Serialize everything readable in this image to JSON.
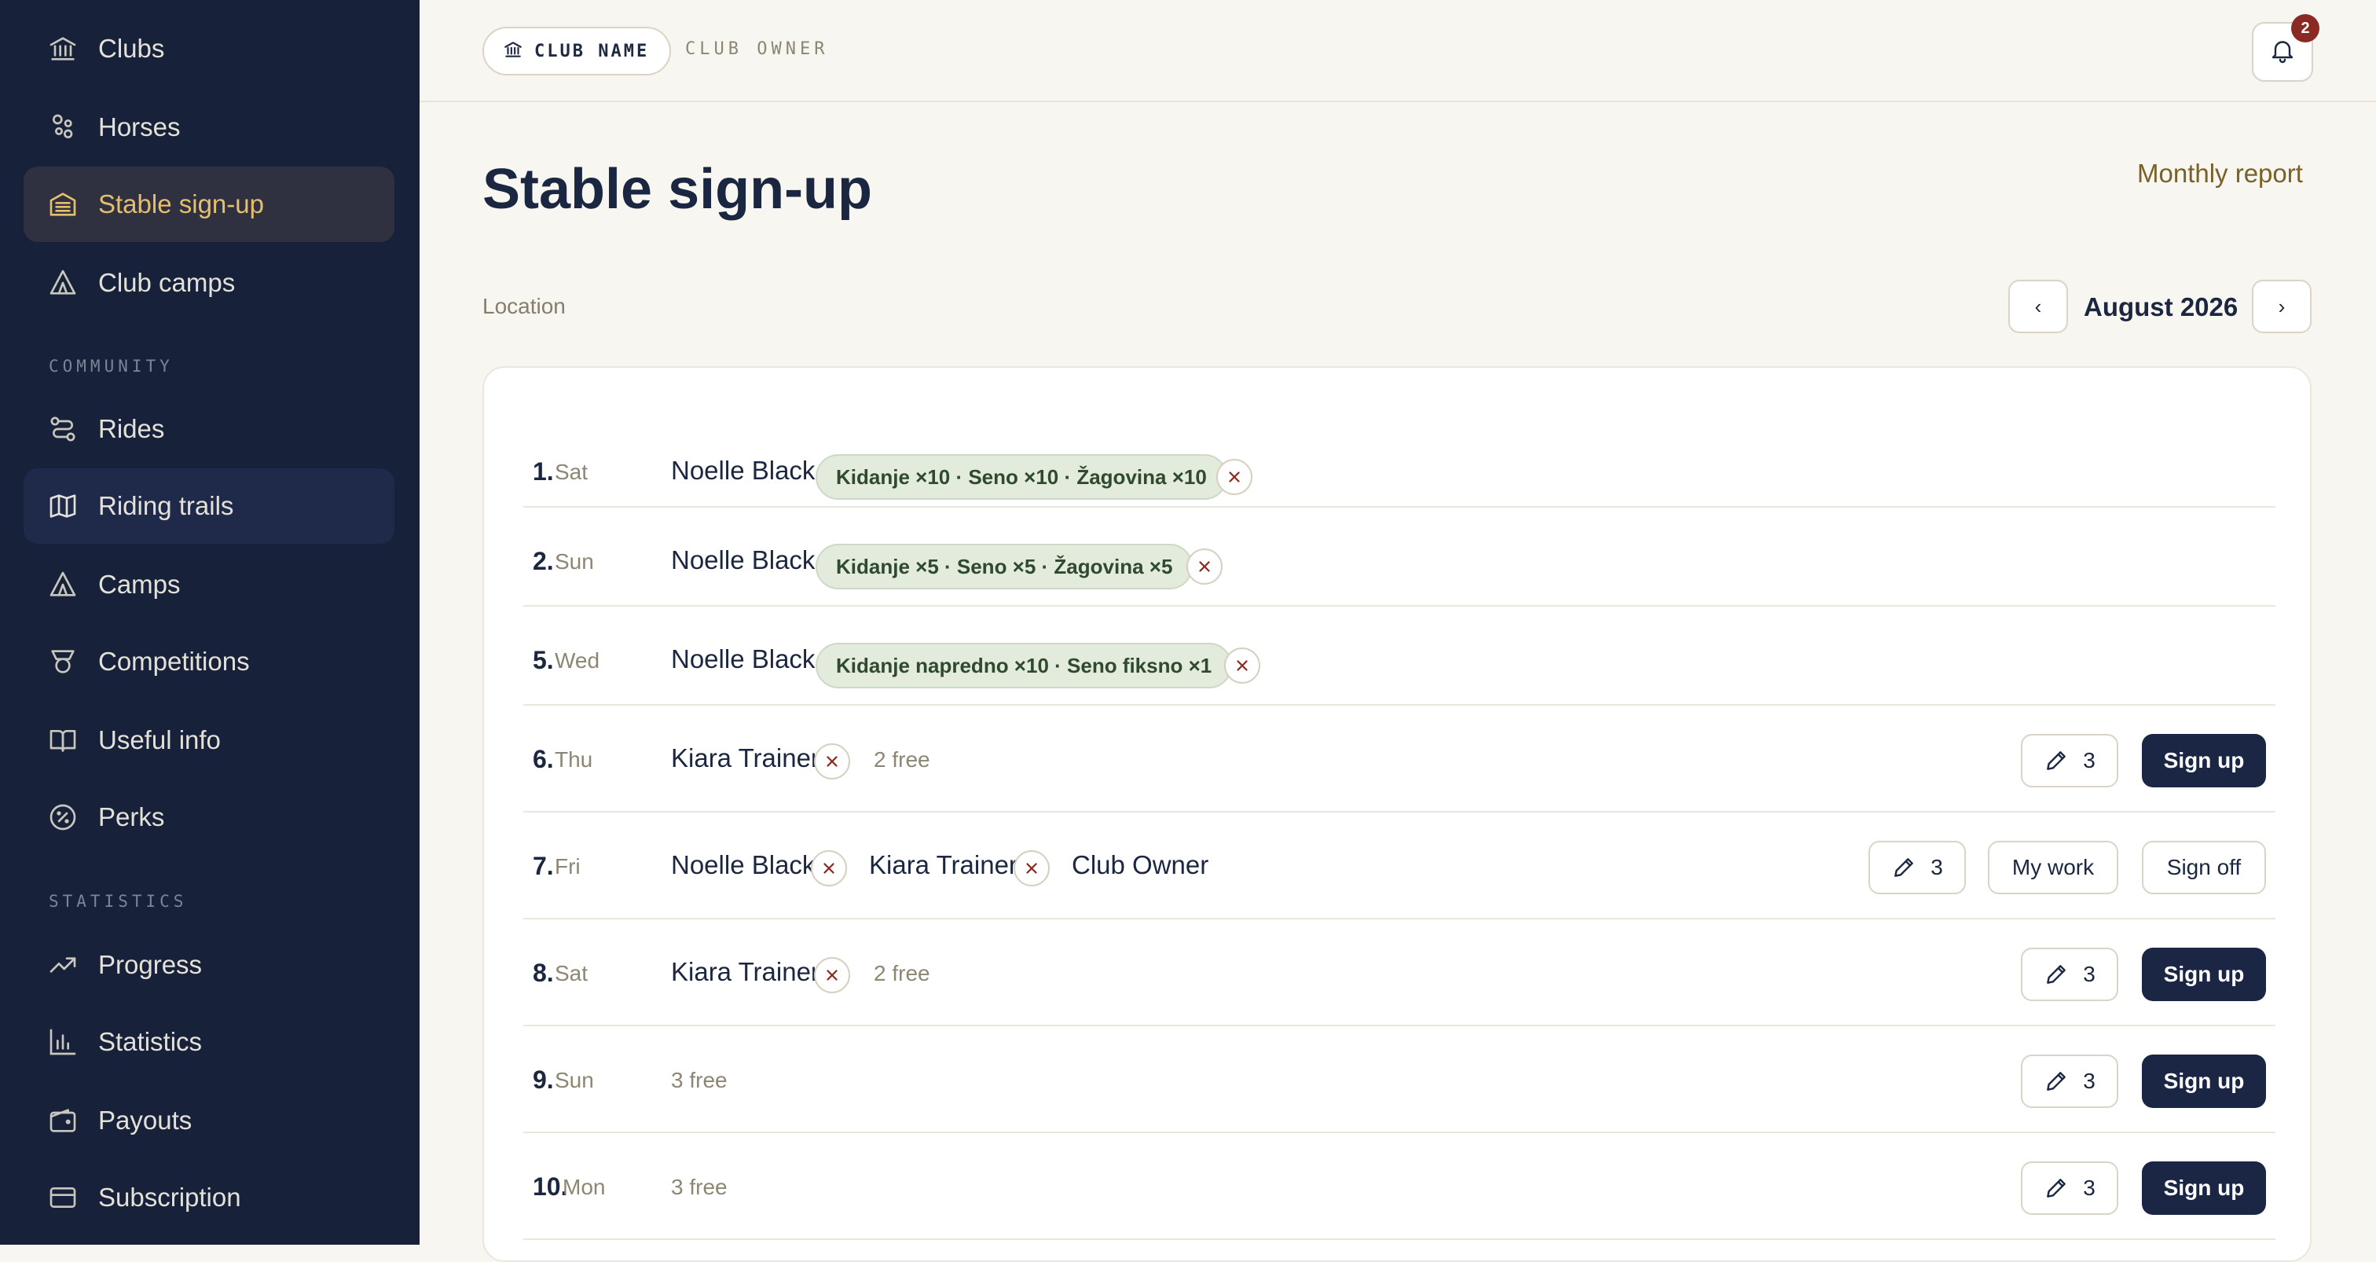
{
  "sidebar": {
    "items_top": [
      {
        "label": "Clubs",
        "icon": "bank-icon"
      },
      {
        "label": "Horses",
        "icon": "horse-icon"
      },
      {
        "label": "Stable sign-up",
        "icon": "stable-icon",
        "active": true
      },
      {
        "label": "Club camps",
        "icon": "tent-icon"
      }
    ],
    "section_community": "COMMUNITY",
    "items_community": [
      {
        "label": "Rides",
        "icon": "route-icon"
      },
      {
        "label": "Riding trails",
        "icon": "map-icon"
      },
      {
        "label": "Camps",
        "icon": "tent-icon"
      },
      {
        "label": "Competitions",
        "icon": "medal-icon"
      },
      {
        "label": "Useful info",
        "icon": "book-icon"
      },
      {
        "label": "Perks",
        "icon": "discount-icon"
      }
    ],
    "section_statistics": "STATISTICS",
    "items_statistics": [
      {
        "label": "Progress",
        "icon": "trending-up-icon"
      },
      {
        "label": "Statistics",
        "icon": "bar-chart-icon"
      },
      {
        "label": "Payouts",
        "icon": "wallet-icon"
      },
      {
        "label": "Subscription",
        "icon": "credit-card-icon"
      }
    ]
  },
  "topbar": {
    "club_name": "CLUB NAME",
    "club_owner": "CLUB OWNER",
    "notification_count": "2"
  },
  "page": {
    "title": "Stable sign-up",
    "monthly_report": "Monthly report",
    "location_label": "Location",
    "prev": "‹",
    "next": "›",
    "month": "August 2026"
  },
  "rows": [
    {
      "num": "1.",
      "day": "Sat",
      "person": "Noelle Black",
      "chip": "Kidanje ×10 · Seno ×10 · Žagovina ×10"
    },
    {
      "num": "2.",
      "day": "Sun",
      "person": "Noelle Black",
      "chip": "Kidanje ×5 · Seno ×5 · Žagovina ×5"
    },
    {
      "num": "5.",
      "day": "Wed",
      "person": "Noelle Black",
      "chip": "Kidanje napredno ×10 · Seno fiksno ×1"
    },
    {
      "num": "6.",
      "day": "Thu",
      "person": "Kiara Trainer",
      "free": "2 free",
      "edit_count": "3",
      "action": "Sign up"
    },
    {
      "num": "7.",
      "day": "Fri",
      "person1": "Noelle Black",
      "person2": "Kiara Trainer",
      "person3": "Club Owner",
      "edit_count": "3",
      "my_work": "My work",
      "action": "Sign off"
    },
    {
      "num": "8.",
      "day": "Sat",
      "person": "Kiara Trainer",
      "free": "2 free",
      "edit_count": "3",
      "action": "Sign up"
    },
    {
      "num": "9.",
      "day": "Sun",
      "free": "3 free",
      "edit_count": "3",
      "action": "Sign up"
    },
    {
      "num": "10.",
      "day": "Mon",
      "free": "3 free",
      "edit_count": "3",
      "action": "Sign up"
    }
  ],
  "colors": {
    "sidebar_bg": "#17213a",
    "accent_gold": "#e3bf6f",
    "primary_navy": "#1b2645",
    "chip_green": "#e3ebdc",
    "badge_red": "#8a2a22"
  }
}
